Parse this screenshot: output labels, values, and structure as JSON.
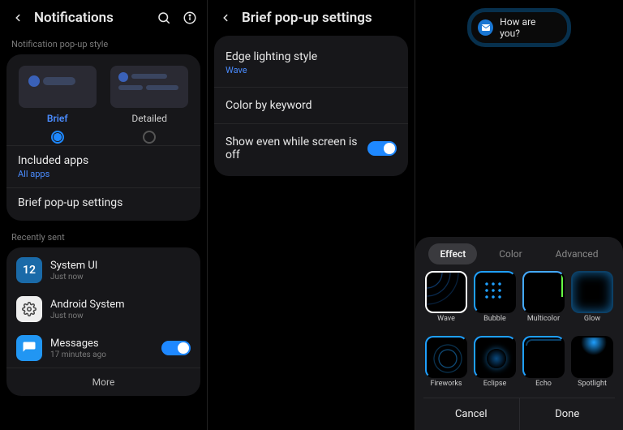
{
  "colors": {
    "accent": "#1e88ff"
  },
  "pane1": {
    "title": "Notifications",
    "section_style": "Notification pop-up style",
    "styles": {
      "brief": "Brief",
      "detailed": "Detailed",
      "selected": "brief"
    },
    "included_apps": {
      "title": "Included apps",
      "sub": "All apps"
    },
    "brief_settings": "Brief pop-up settings",
    "section_recent": "Recently sent",
    "recent": [
      {
        "app": "System UI",
        "time": "Just now",
        "icon": "sysui",
        "toggle": null
      },
      {
        "app": "Android System",
        "time": "Just now",
        "icon": "android",
        "toggle": null
      },
      {
        "app": "Messages",
        "time": "17 minutes ago",
        "icon": "messages",
        "toggle": true
      }
    ],
    "more": "More"
  },
  "pane2": {
    "title": "Brief pop-up settings",
    "rows": {
      "edge": {
        "title": "Edge lighting style",
        "sub": "Wave"
      },
      "color": {
        "title": "Color by keyword"
      },
      "show_off": {
        "title": "Show even while screen is off",
        "on": true
      }
    }
  },
  "pane3": {
    "notification_text": "How are you?",
    "tabs": {
      "effect": "Effect",
      "color": "Color",
      "advanced": "Advanced",
      "active": "effect"
    },
    "effects": [
      {
        "name": "Wave",
        "selected": true
      },
      {
        "name": "Bubble"
      },
      {
        "name": "Multicolor"
      },
      {
        "name": "Glow"
      },
      {
        "name": "Fireworks"
      },
      {
        "name": "Eclipse"
      },
      {
        "name": "Echo"
      },
      {
        "name": "Spotlight"
      }
    ],
    "cancel": "Cancel",
    "done": "Done"
  }
}
